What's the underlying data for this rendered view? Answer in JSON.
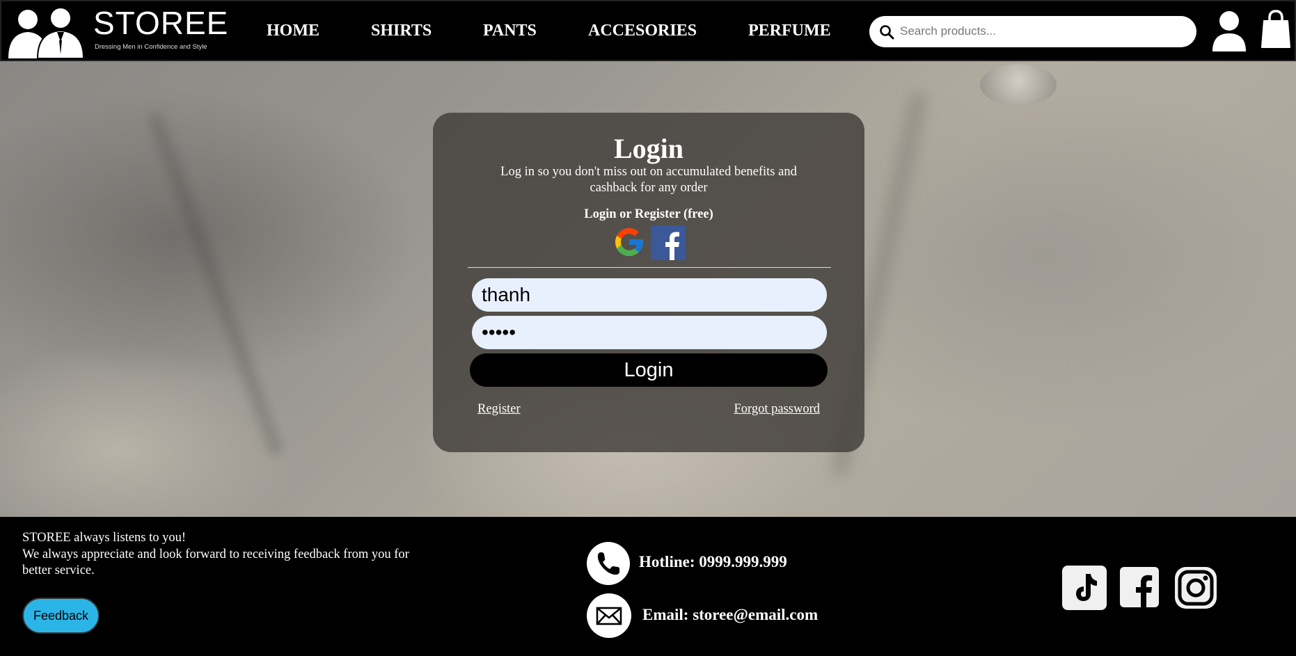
{
  "header": {
    "logo_name": "STOREE",
    "logo_tagline": "Dressing Men in Confidence and Style",
    "nav": [
      {
        "label": "HOME"
      },
      {
        "label": "SHIRTS"
      },
      {
        "label": "PANTS"
      },
      {
        "label": "ACCESORIES"
      },
      {
        "label": "PERFUME"
      }
    ],
    "search_placeholder": "Search products...",
    "icons": [
      "logo-men-icon",
      "search-icon",
      "user-icon",
      "shopping-bag-icon"
    ]
  },
  "login": {
    "title": "Login",
    "subtitle": "Log in so you don't miss out on accumulated benefits and cashback for any order",
    "social_prompt": "Login or Register (free)",
    "social_icons": [
      "google-icon",
      "facebook-icon"
    ],
    "username_value": "thanh",
    "password_value": "•••••",
    "login_button": "Login",
    "register_link": "Register",
    "forgot_link": "Forgot password"
  },
  "footer": {
    "title": "STOREE always listens to you!",
    "text": "We always appreciate and look forward to receiving feedback from you for better service.",
    "feedback_button": "Feedback",
    "hotline": "Hotline: 0999.999.999",
    "email": "Email: storee@email.com",
    "social_icons": [
      "tiktok-icon",
      "facebook-icon",
      "instagram-icon"
    ],
    "colors": {
      "feedback_button": "#2bb5e6",
      "background": "#000000"
    }
  }
}
